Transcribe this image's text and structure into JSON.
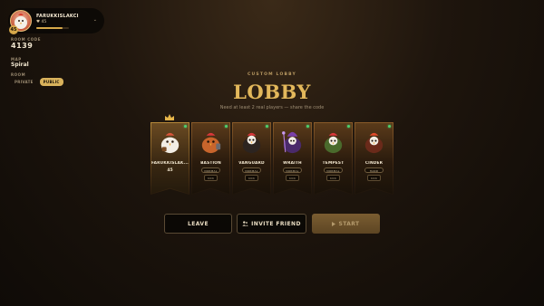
{
  "player": {
    "name": "FARUKKISLAKCI",
    "level_badge": "45",
    "level_text": "45",
    "xp_fraction": 0.8,
    "chevron": "⌄"
  },
  "sidebar": {
    "room_code_label": "ROOM CODE",
    "room_code": "4139",
    "map_label": "MAP",
    "map_name": "Spiral",
    "room_label": "ROOM",
    "private_label": "PRIVATE",
    "public_label": "PUBLIC"
  },
  "lobby": {
    "eyebrow": "CUSTOM LOBBY",
    "title": "LOBBY",
    "subtitle": "Need at least 2 real players — share the code"
  },
  "slots": [
    {
      "name": "FARUKKISLAK...",
      "level": "45",
      "is_host": true,
      "color": "#d9553a"
    },
    {
      "name": "BASTION",
      "difficulty": "NORMAL",
      "kick": "KICK",
      "color": "#c8652c"
    },
    {
      "name": "VANGUARD",
      "difficulty": "NORMAL",
      "kick": "KICK",
      "color": "#b63a2a"
    },
    {
      "name": "WRAITH",
      "difficulty": "NORMAL",
      "kick": "KICK",
      "color": "#7a3fa8"
    },
    {
      "name": "TEMPEST",
      "difficulty": "NORMAL",
      "kick": "KICK",
      "color": "#5b8a3a"
    },
    {
      "name": "CINDER",
      "difficulty": "HARD",
      "kick": "KICK",
      "color": "#d44a2a"
    }
  ],
  "actions": {
    "leave": "LEAVE",
    "invite": "INVITE FRIEND",
    "start": "START"
  },
  "icons": {
    "invite": "people-icon",
    "start": "play-icon",
    "host": "crown-icon"
  }
}
